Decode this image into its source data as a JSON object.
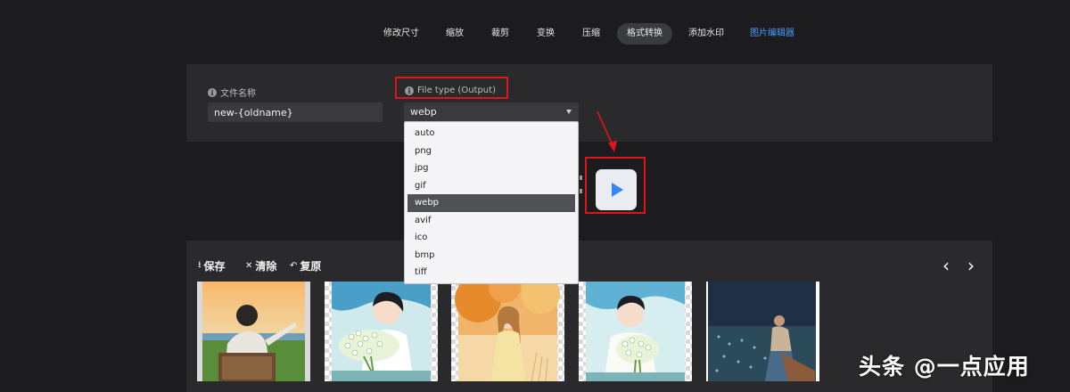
{
  "nav": {
    "tabs": [
      {
        "label": "修改尺寸"
      },
      {
        "label": "缩放"
      },
      {
        "label": "裁剪"
      },
      {
        "label": "变换"
      },
      {
        "label": "压缩"
      },
      {
        "label": "格式转换",
        "active": true
      },
      {
        "label": "添加水印"
      },
      {
        "label": "图片编辑器",
        "accent": "#4d9cff"
      }
    ]
  },
  "settings": {
    "filename_label": "文件名称",
    "filename_value": "new-{oldname}",
    "filetype_label": "File type (Output)",
    "filetype_value": "webp"
  },
  "dropdown": {
    "options": [
      "auto",
      "png",
      "jpg",
      "gif",
      "webp",
      "avif",
      "ico",
      "bmp",
      "tiff"
    ],
    "selected": "webp"
  },
  "actions": {
    "save": "保存",
    "clear": "清除",
    "restore": "复原"
  },
  "watermark": "头条 @一点应用",
  "colors": {
    "accent": "#2f88f4",
    "highlight": "#e0141a",
    "background": "#1c1c1e",
    "panel": "#2a2a2c"
  },
  "icons": [
    "info-icon",
    "caret-down-icon",
    "play-icon",
    "download-icon",
    "close-icon",
    "undo-icon",
    "chevron-left-icon",
    "chevron-right-icon"
  ]
}
